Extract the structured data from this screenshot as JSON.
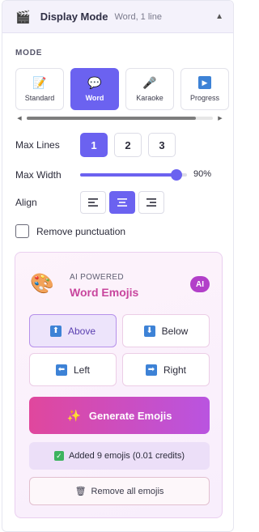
{
  "header": {
    "title": "Display Mode",
    "subtitle": "Word, 1 line",
    "icon": "clapperboard-icon",
    "chevron": "▲"
  },
  "mode": {
    "section_label": "MODE",
    "options": [
      {
        "label": "Standard",
        "icon": "📝",
        "active": false
      },
      {
        "label": "Word",
        "icon": "💬",
        "active": true
      },
      {
        "label": "Karaoke",
        "icon": "🎤",
        "active": false
      },
      {
        "label": "Progress",
        "icon": "▶",
        "active": false
      }
    ]
  },
  "max_lines": {
    "label": "Max Lines",
    "options": [
      "1",
      "2",
      "3"
    ],
    "selected": "1"
  },
  "max_width": {
    "label": "Max Width",
    "value": 90,
    "display": "90%"
  },
  "align": {
    "label": "Align",
    "selected": "center"
  },
  "remove_punctuation": {
    "label": "Remove punctuation",
    "checked": false
  },
  "emoji": {
    "powered_label": "AI POWERED",
    "title": "Word Emojis",
    "badge": "AI",
    "positions": [
      {
        "label": "Above",
        "icon": "⬆",
        "active": true
      },
      {
        "label": "Below",
        "icon": "⬇",
        "active": false
      },
      {
        "label": "Left",
        "icon": "⬅",
        "active": false
      },
      {
        "label": "Right",
        "icon": "➡",
        "active": false
      }
    ],
    "generate_label": "Generate Emojis",
    "generate_icon": "✨",
    "status_text": "Added 9 emojis (0.01 credits)",
    "remove_label": "Remove all emojis",
    "remove_icon": "🗑"
  },
  "colors": {
    "accent": "#6b62f0",
    "pink": "#c8459d",
    "badge": "#b23fc9"
  }
}
